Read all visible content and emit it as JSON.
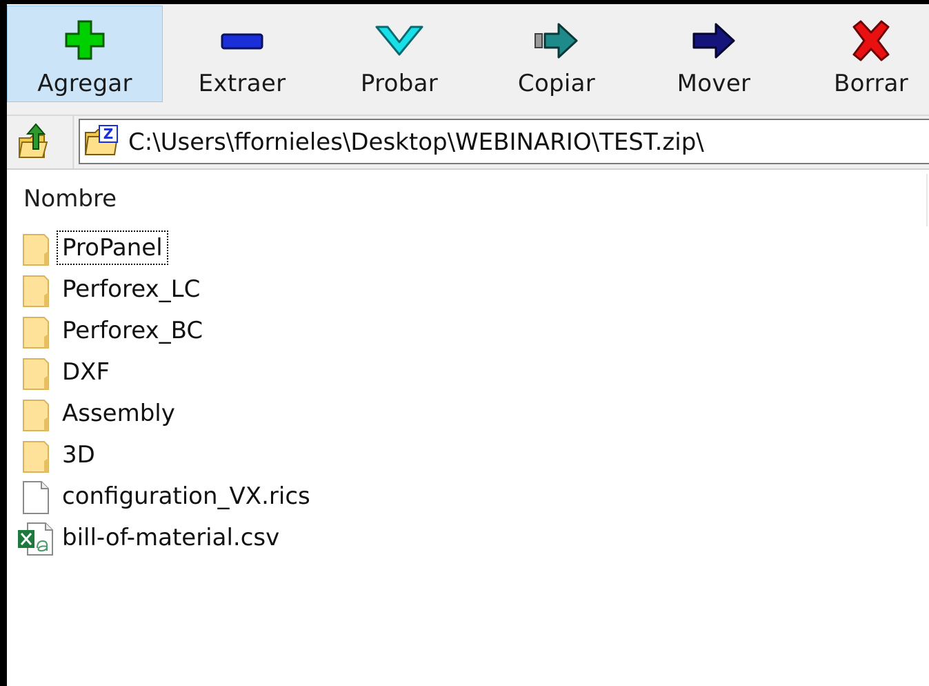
{
  "toolbar": {
    "buttons": [
      {
        "label": "Agregar",
        "icon": "plus-icon",
        "color": "#00d000"
      },
      {
        "label": "Extraer",
        "icon": "minus-icon",
        "color": "#1a2fd8"
      },
      {
        "label": "Probar",
        "icon": "check-icon",
        "color": "#17e0e8"
      },
      {
        "label": "Copiar",
        "icon": "copy-arrow-icon",
        "color": "#1f8a8a"
      },
      {
        "label": "Mover",
        "icon": "move-arrow-icon",
        "color": "#14147a"
      },
      {
        "label": "Borrar",
        "icon": "delete-x-icon",
        "color": "#e81010"
      }
    ]
  },
  "address": {
    "path": "C:\\Users\\ffornieles\\Desktop\\WEBINARIO\\TEST.zip\\"
  },
  "list": {
    "column_header": "Nombre",
    "items": [
      {
        "name": "ProPanel",
        "type": "folder"
      },
      {
        "name": "Perforex_LC",
        "type": "folder"
      },
      {
        "name": "Perforex_BC",
        "type": "folder"
      },
      {
        "name": "DXF",
        "type": "folder"
      },
      {
        "name": "Assembly",
        "type": "folder"
      },
      {
        "name": "3D",
        "type": "folder"
      },
      {
        "name": "configuration_VX.rics",
        "type": "file"
      },
      {
        "name": "bill-of-material.csv",
        "type": "excel-file"
      }
    ]
  }
}
